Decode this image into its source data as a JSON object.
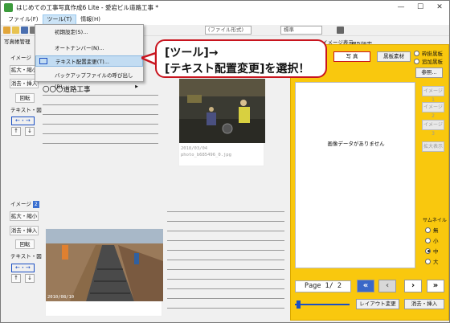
{
  "titlebar": {
    "title": "はじめての工事写真作成6 Lite - 愛宕ビル道路工事 *",
    "minimize": "—",
    "maximize": "☐",
    "close": "✕"
  },
  "menubar": {
    "items": [
      "ファイル(F)",
      "ツール(T)",
      "情報(H)"
    ]
  },
  "toolbar": {
    "partial_select": "(ファイル形式)",
    "select_value": "標準"
  },
  "tools_menu": {
    "items": [
      "初期設定(S)...",
      "オートナンバー(N)...",
      "テキスト配置変更(T)...",
      "バックアップファイルの呼び出し(B)..."
    ],
    "highlighted": "テキスト配置変更(T)...",
    "submenu_arrow": "▶"
  },
  "callout": {
    "line1": "[ツール]→",
    "line2": "[テキスト配置変更]を選択！"
  },
  "left_top": {
    "tab_label": "写真帳管理",
    "partial_no": "No",
    "image_label": "イメージ",
    "image_badge": "1",
    "buttons": [
      "拡大・縮小",
      "消去・挿入",
      "回転",
      "テキスト・図"
    ],
    "arrow_row": "←・→",
    "text_line": "〇〇〇道路工事",
    "photo_caption": [
      "2018/03/04",
      "photo_b685496_0.jpg"
    ]
  },
  "left_bottom": {
    "image_label": "イメージ",
    "image_badge": "2",
    "buttons": [
      "拡大・縮小",
      "消去・挿入",
      "回転",
      "テキスト・図"
    ],
    "arrow_row": "←・→",
    "photo_date": "2010/08/10"
  },
  "right_tabs": {
    "items": [
      "イメージ表示",
      "個別設定"
    ]
  },
  "right": {
    "photo_btn": "写 真",
    "board_btn": "黒板素材",
    "radio_opts": [
      "砕掛黒板",
      "追加黒板"
    ],
    "ref_btn": "参照...",
    "no_image": "画像データがありません",
    "image_btns": [
      "イメージ1",
      "イメージ2",
      "イメージ3"
    ],
    "zoom_btn": "拡大表示",
    "thumb_label": "サムネイル",
    "thumb_opts": [
      "無",
      "小",
      "中",
      "大"
    ],
    "thumb_selected": "中",
    "page_label": "Page 1/ 2",
    "nav_first": "«",
    "nav_prev": "‹",
    "nav_next": "›",
    "nav_last": "»",
    "layout_btn": "レイアウト変更",
    "erase_btn": "消去・挿入"
  }
}
